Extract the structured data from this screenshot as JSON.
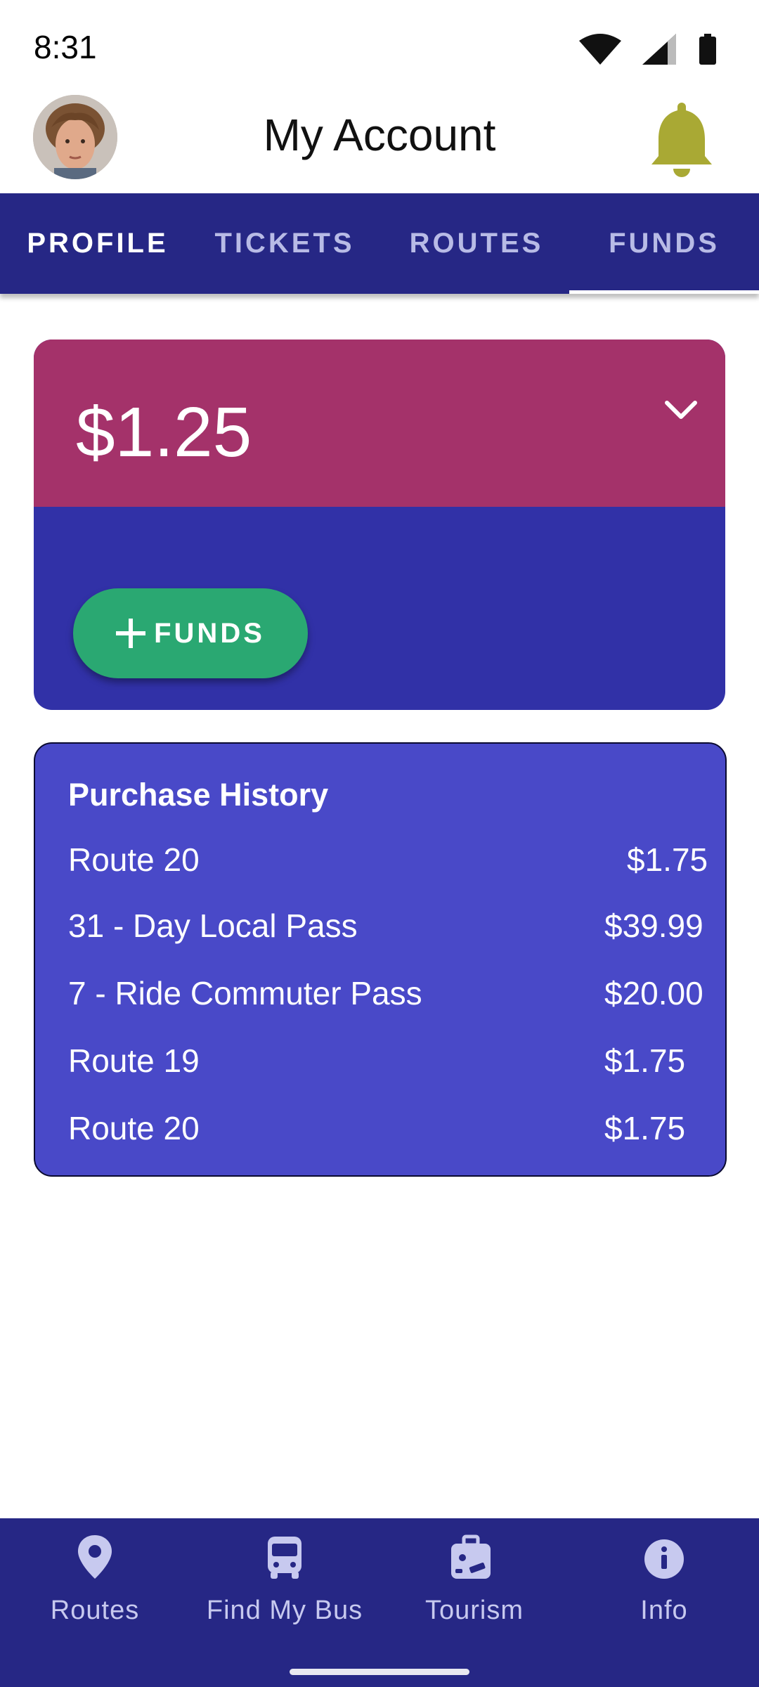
{
  "status_bar": {
    "time": "8:31"
  },
  "header": {
    "title": "My Account"
  },
  "tabs": [
    {
      "label": "PROFILE"
    },
    {
      "label": "TICKETS"
    },
    {
      "label": "ROUTES"
    },
    {
      "label": "FUNDS"
    }
  ],
  "active_tab": "FUNDS",
  "funds": {
    "balance": "$1.25",
    "add_button_label": "FUNDS"
  },
  "purchase_history": {
    "title": "Purchase History",
    "items": [
      {
        "name": "Route 20",
        "price": "$1.75"
      },
      {
        "name": "31 - Day Local Pass",
        "price": "$39.99"
      },
      {
        "name": "7 - Ride Commuter Pass",
        "price": "$20.00"
      },
      {
        "name": "Route 19",
        "price": "$1.75"
      },
      {
        "name": "Route 20",
        "price": "$1.75"
      }
    ]
  },
  "bottom_nav": [
    {
      "label": "Routes",
      "icon": "map-pin-icon"
    },
    {
      "label": "Find My Bus",
      "icon": "bus-icon"
    },
    {
      "label": "Tourism",
      "icon": "suitcase-icon"
    },
    {
      "label": "Info",
      "icon": "info-icon"
    }
  ],
  "colors": {
    "primary_dark": "#262785",
    "balance_bg": "#a4326a",
    "card_bg": "#3131a7",
    "history_bg": "#4949c8",
    "add_button": "#2aa872",
    "bell": "#a9a934"
  }
}
